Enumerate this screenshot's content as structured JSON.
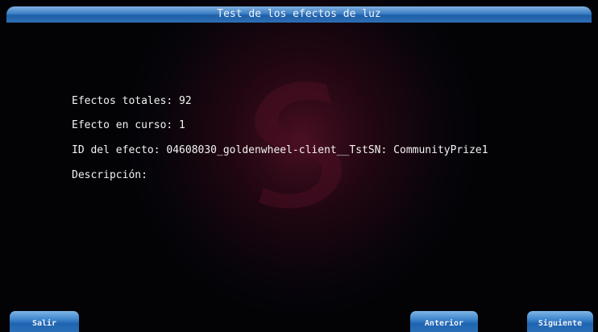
{
  "window": {
    "title": "Test de los efectos de luz"
  },
  "info": {
    "total_effects": "Efectos totales: 92",
    "current_effect": "Efecto en curso: 1",
    "effect_id": "ID del efecto: 04608030_goldenwheel-client__TstSN: CommunityPrize1",
    "description": "Descripción:"
  },
  "buttons": {
    "exit": "Salir",
    "previous": "Anterior",
    "next": "Siguiente"
  },
  "colors": {
    "title_bar": "#3d7fc4",
    "button": "#2f75bd",
    "background": "#05040a",
    "logo_glow": "#3a0a1c"
  },
  "icons": {
    "background_logo": "s-swirl-logo"
  }
}
